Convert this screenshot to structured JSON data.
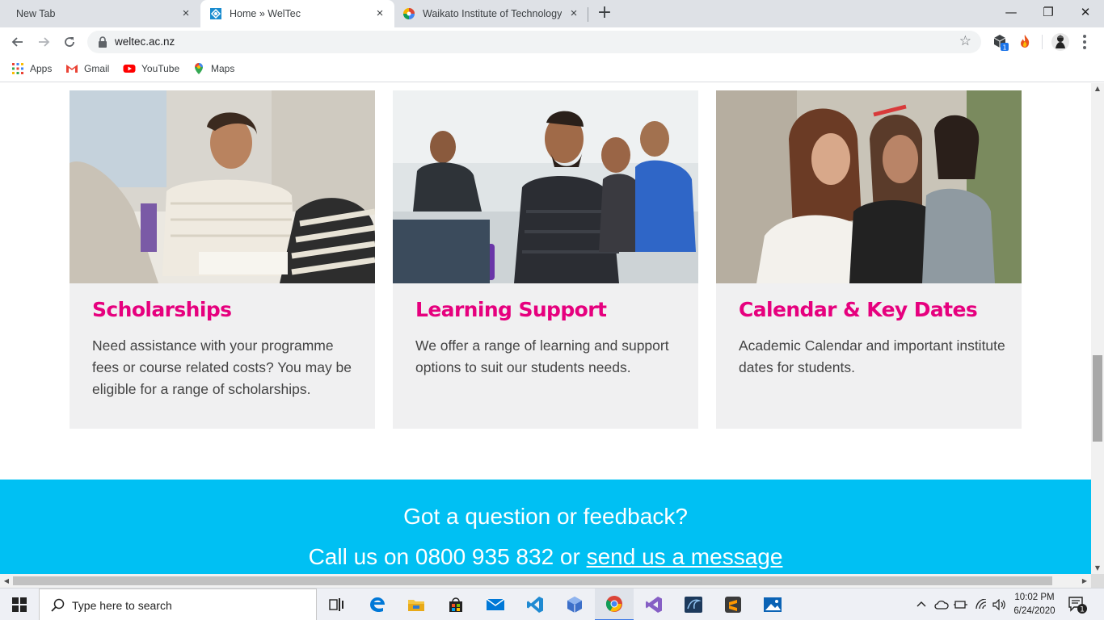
{
  "browser": {
    "tabs": [
      {
        "title": "New Tab",
        "active": false
      },
      {
        "title": "Home » WelTec",
        "active": true
      },
      {
        "title": "Waikato Institute of Technology",
        "active": false
      }
    ],
    "close_glyph": "×",
    "new_tab_glyph": "+",
    "window_controls": {
      "minimize": "—",
      "restore": "❐",
      "close": "✕"
    },
    "url": "weltec.ac.nz",
    "extension_badge": "1",
    "bookmarks": [
      {
        "label": "Apps",
        "icon": "apps-grid-icon"
      },
      {
        "label": "Gmail",
        "icon": "gmail-icon"
      },
      {
        "label": "YouTube",
        "icon": "youtube-icon"
      },
      {
        "label": "Maps",
        "icon": "maps-pin-icon"
      }
    ]
  },
  "page": {
    "cards": [
      {
        "title": "Scholarships",
        "text": "Need assistance with your programme fees or course related costs? You may be eligible for a range of scholarships."
      },
      {
        "title": "Learning Support",
        "text": "We offer a range of learning and support options to suit our students needs."
      },
      {
        "title": "Calendar & Key Dates",
        "text": "Academic Calendar and important institute dates for students."
      }
    ],
    "cta": {
      "question": "Got a question or feedback?",
      "call_prefix": "Call us on 0800 935 832 or ",
      "link": "send us a message"
    },
    "colors": {
      "accent": "#e6007e",
      "cta_bg": "#00c0f3",
      "card_bg": "#f0f0f1"
    }
  },
  "taskbar": {
    "search_placeholder": "Type here to search",
    "time": "10:02 PM",
    "date": "6/24/2020",
    "notification_count": "1",
    "apps": [
      "task-view-icon",
      "edge-icon",
      "file-explorer-icon",
      "store-icon",
      "mail-icon",
      "vscode-icon",
      "box-icon",
      "chrome-icon",
      "visual-studio-icon",
      "database-icon",
      "sublime-icon",
      "photos-icon"
    ]
  }
}
